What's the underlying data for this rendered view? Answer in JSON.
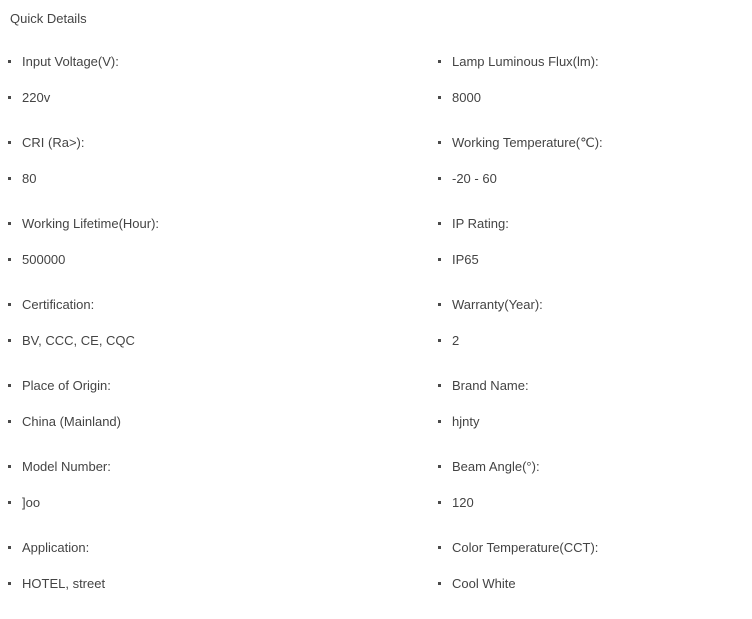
{
  "section": {
    "title": "Quick Details"
  },
  "bullet_glyph": "square-dot",
  "colors": {
    "background": "#ffffff",
    "text": "#444444",
    "bullet": "#4a4a4a"
  },
  "specs": {
    "left_column": [
      {
        "label": "Input Voltage(V):",
        "value": "220v"
      },
      {
        "label": "CRI (Ra>):",
        "value": "80"
      },
      {
        "label": "Working Lifetime(Hour):",
        "value": "500000"
      },
      {
        "label": "Certification:",
        "value": "BV, CCC, CE, CQC"
      },
      {
        "label": "Place of Origin:",
        "value": "China (Mainland)"
      },
      {
        "label": "Model Number:",
        "value": "]oo"
      },
      {
        "label": "Application:",
        "value": "HOTEL, street"
      }
    ],
    "right_column": [
      {
        "label": "Lamp Luminous Flux(lm):",
        "value": "8000"
      },
      {
        "label": "Working Temperature(℃):",
        "value": "-20 - 60"
      },
      {
        "label": "IP Rating:",
        "value": "IP65"
      },
      {
        "label": "Warranty(Year):",
        "value": "2"
      },
      {
        "label": "Brand Name:",
        "value": "hjnty"
      },
      {
        "label": "Beam Angle(°):",
        "value": "120"
      },
      {
        "label": "Color Temperature(CCT):",
        "value": "Cool White"
      }
    ]
  }
}
